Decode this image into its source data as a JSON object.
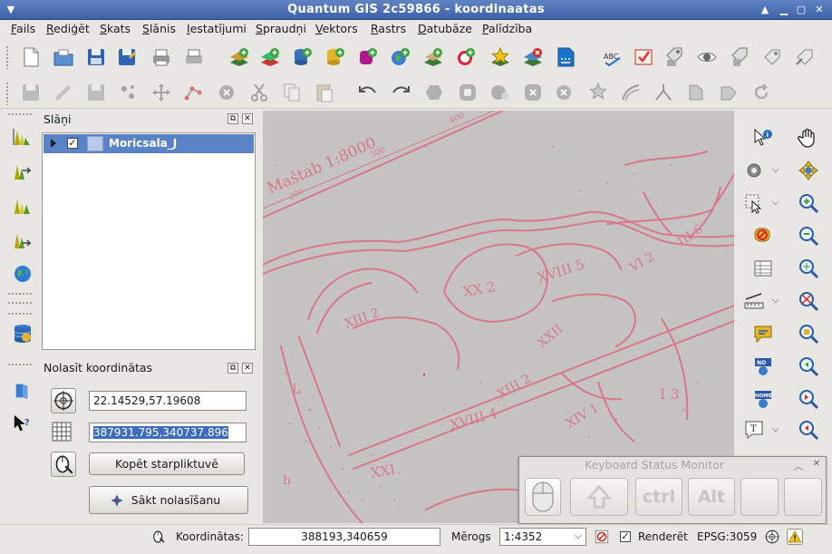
{
  "window": {
    "title": "Quantum GIS 2c59866 - koordinaatas"
  },
  "menu": [
    "Fails",
    "Rediģēt",
    "Skats",
    "Slānis",
    "Iestatījumi",
    "Spraudņi",
    "Vektors",
    "Rastrs",
    "Datubāze",
    "Palīdzība"
  ],
  "layers_panel": {
    "title": "Slāņi",
    "layers": [
      {
        "name": "Moricsala_J",
        "checked": true
      }
    ]
  },
  "coord_panel": {
    "title": "Nolasīt koordinātas",
    "wgs84_value": "22.14529,57.19608",
    "project_value": "387931.795,340737.896",
    "copy_button": "Kopēt starpliktuvē",
    "start_button": "Sākt nolasīšanu"
  },
  "keyboard_monitor": {
    "title": "Keyboard Status Monitor",
    "keys": [
      "ctrl",
      "Alt"
    ]
  },
  "statusbar": {
    "coord_label": "Koordinātas:",
    "coord_value": "388193,340659",
    "scale_label": "Mērogs",
    "scale_value": "1:4352",
    "render_label": "Renderēt",
    "render_checked": true,
    "crs": "EPSG:3059"
  },
  "map_labels": {
    "scale_text": "Maštab 1:8000",
    "num_400": "400",
    "num_300": "300",
    "num_200": "200",
    "zones": [
      "XX 2",
      "XVIII 5",
      "XIII 2",
      "XIII 2",
      "XVIII 4",
      "XXI",
      "XXII",
      "XIV 1",
      "VI 2",
      "III 6",
      "I 3",
      "L",
      "h"
    ]
  },
  "colors": {
    "title_bar": "#4a6db4",
    "selection": "#5a82c6",
    "map_background": "#c6c3c3",
    "map_ink": "#d8788a"
  }
}
